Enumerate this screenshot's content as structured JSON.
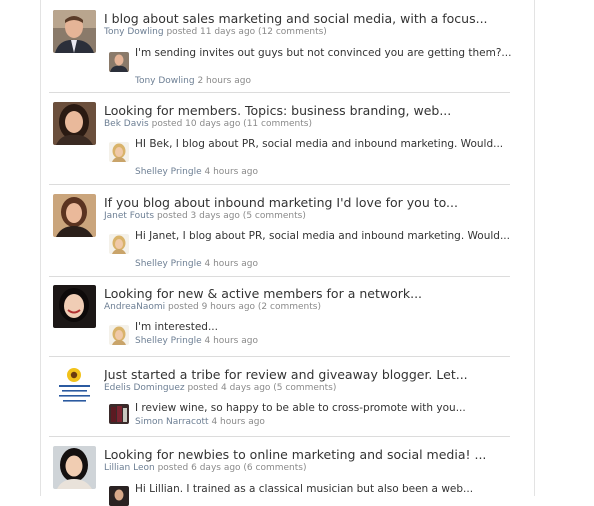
{
  "threads": [
    {
      "title": "I blog about sales marketing and social media, with a focus...",
      "author": "Tony Dowling",
      "posted": "posted 11 days ago (12 comments)",
      "reply_text": "I'm sending invites out guys but not convinced you are getting them?...",
      "reply_author": "Tony Dowling",
      "reply_time": "2 hours ago",
      "avatar_icon": "man-in-suit-photo",
      "reply_icon": "man-in-suit-photo"
    },
    {
      "title": "Looking for members. Topics: business branding, web...",
      "author": "Bek Davis",
      "posted": "posted 10 days ago (11 comments)",
      "reply_text": "HI Bek, I blog about PR, social media and inbound marketing. Would...",
      "reply_author": "Shelley Pringle",
      "reply_time": "4 hours ago",
      "avatar_icon": "woman-dark-hair-photo",
      "reply_icon": "blonde-woman-photo"
    },
    {
      "title": "If you blog about inbound marketing I'd love for you to...",
      "author": "Janet Fouts",
      "posted": "posted 3 days ago (5 comments)",
      "reply_text": "Hi Janet, I blog about PR, social media and inbound marketing. Would...",
      "reply_author": "Shelley Pringle",
      "reply_time": "4 hours ago",
      "avatar_icon": "woman-brown-hair-photo",
      "reply_icon": "blonde-woman-photo"
    },
    {
      "title": "Looking for new & active members for a network...",
      "author": "AndreaNaomi",
      "posted": "posted 9 hours ago (2 comments)",
      "reply_text": "I'm interested...",
      "reply_author": "Shelley Pringle",
      "reply_time": "4 hours ago",
      "avatar_icon": "smiling-woman-photo",
      "reply_icon": "blonde-woman-photo"
    },
    {
      "title": "Just started a tribe for review and giveaway blogger. Let...",
      "author": "Edelis Dominguez",
      "posted": "posted 4 days ago (5 comments)",
      "reply_text": "I review wine, so happy to be able to cross-promote with you...",
      "reply_author": "Simon Narracott",
      "reply_time": "4 hours ago",
      "avatar_icon": "sunflower-blog-logo",
      "reply_icon": "wine-photo"
    },
    {
      "title": "Looking for newbies to online marketing and social media! ...",
      "author": "Lillian Leon",
      "posted": "posted 6 days ago (6 comments)",
      "reply_text": "Hi Lillian. I trained as a classical musician but also been a web...",
      "reply_author": "",
      "reply_time": "",
      "avatar_icon": "asian-woman-photo",
      "reply_icon": "musician-photo"
    }
  ]
}
